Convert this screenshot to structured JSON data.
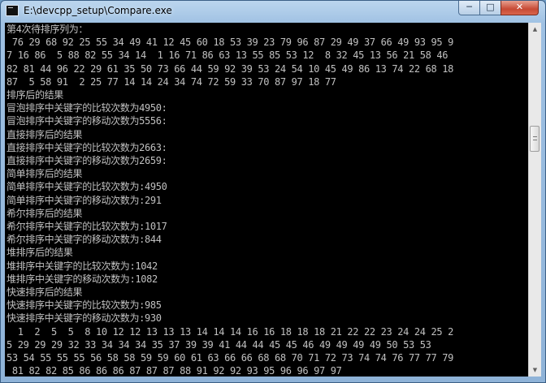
{
  "window": {
    "title": "E:\\devcpp_setup\\Compare.exe",
    "minimize_glyph": "─",
    "maximize_glyph": "□",
    "close_glyph": "✕",
    "icon": "console-app-icon"
  },
  "console": {
    "lines": [
      "第4次待排序列为：",
      " 76 29 68 92 25 55 34 49 41 12 45 60 18 53 39 23 79 96 87 29 49 37 66 49 93 95 9",
      "7 16 86  5 88 82 55 34 14  1 16 71 86 63 13 55 85 53 12  8 32 45 13 56 21 58 46",
      "82 81 44 96 22 29 61 35 50 73 66 44 59 92 39 53 24 54 10 45 49 86 13 74 22 68 18",
      "87  5 58 91  2 25 77 14 14 24 34 74 72 59 33 70 87 97 18 77",
      "排序后的结果",
      "冒泡排序中关键字的比较次数为4950:",
      "冒泡排序中关键字的移动次数为5556:",
      "直接排序后的结果",
      "直接排序中关键字的比较次数为2663:",
      "直接排序中关键字的移动次数为2659:",
      "简单排序后的结果",
      "简单排序中关键字的比较次数为:4950",
      "简单排序中关键字的移动次数为:291",
      "希尔排序后的结果",
      "希尔排序中关键字的比较次数为:1017",
      "希尔排序中关键字的移动次数为:844",
      "堆排序后的结果",
      "堆排序中关键字的比较次数为:1042",
      "堆排序中关键字的移动次数为:1082",
      "快速排序后的结果",
      "快速排序中关键字的比较次数为:985",
      "快速排序中关键字的移动次数为:930",
      "  1  2  5  5  8 10 12 12 13 13 13 14 14 14 16 16 18 18 18 21 22 22 23 24 24 25 2",
      "5 29 29 29 32 33 34 34 34 35 37 39 39 41 44 44 45 45 46 49 49 49 49 50 53 53",
      "53 54 55 55 55 56 58 58 59 59 60 61 63 66 66 68 68 70 71 72 73 74 74 76 77 77 79",
      " 81 82 82 85 86 86 86 87 87 87 88 91 92 92 93 95 96 96 97 97"
    ]
  },
  "scrollbar": {
    "up_glyph": "▲",
    "down_glyph": "▼"
  }
}
